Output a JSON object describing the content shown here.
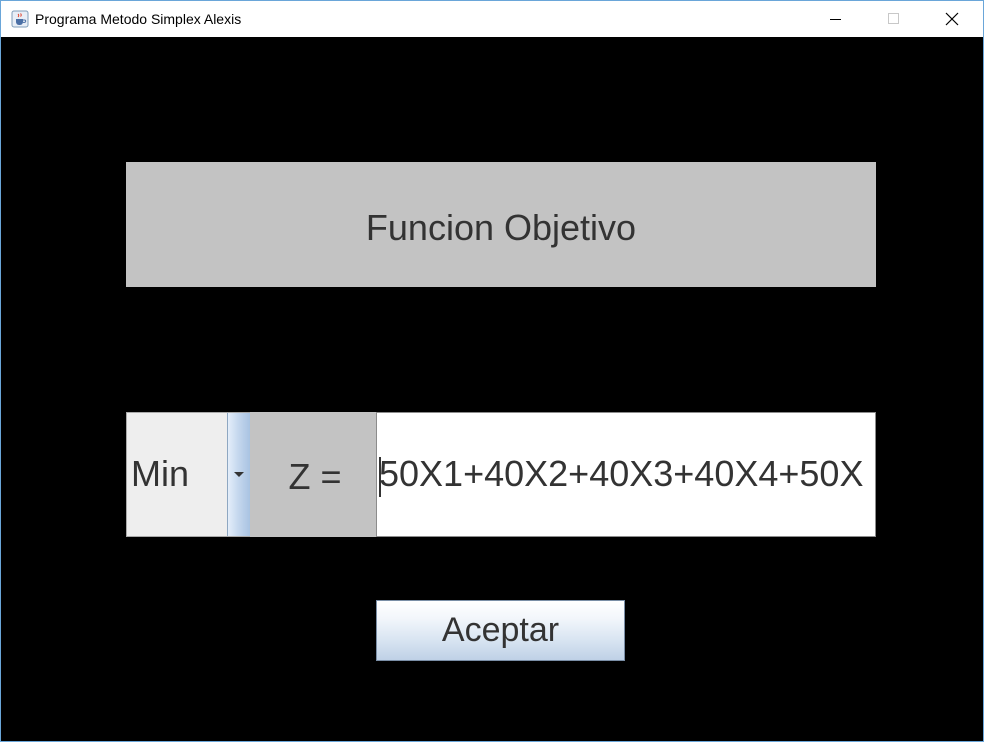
{
  "window": {
    "title": "Programa Metodo Simplex Alexis"
  },
  "header": {
    "label": "Funcion Objetivo"
  },
  "objective": {
    "mode_selected": "Min",
    "z_label": "Z =",
    "expression": "50X1+40X2+40X3+40X4+50X"
  },
  "actions": {
    "accept_label": "Aceptar"
  },
  "icons": {
    "app": "java-cup-icon",
    "minimize": "minimize-icon",
    "maximize": "maximize-icon",
    "close": "close-icon",
    "dropdown": "chevron-down-icon"
  }
}
